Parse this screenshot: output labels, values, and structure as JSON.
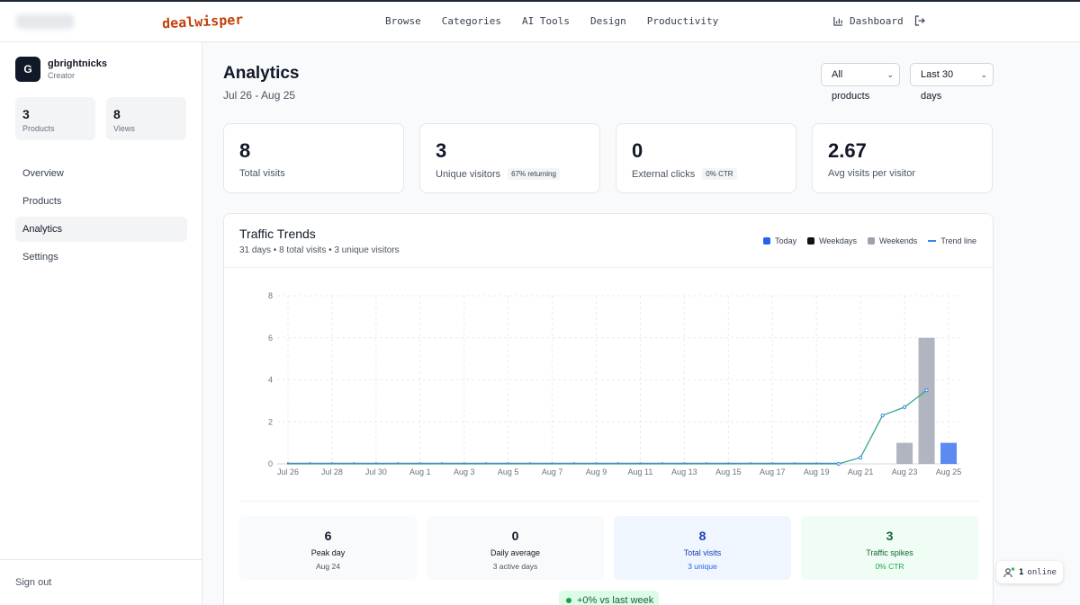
{
  "header": {
    "brand": "dealwisper",
    "nav": [
      "Browse",
      "Categories",
      "AI Tools",
      "Design",
      "Productivity"
    ],
    "dashboard_label": "Dashboard"
  },
  "sidebar": {
    "user": {
      "initial": "G",
      "name": "gbrightnicks",
      "role": "Creator"
    },
    "stats": [
      {
        "value": "3",
        "label": "Products"
      },
      {
        "value": "8",
        "label": "Views"
      }
    ],
    "nav": [
      "Overview",
      "Products",
      "Analytics",
      "Settings"
    ],
    "active": "Analytics",
    "signout": "Sign out"
  },
  "page": {
    "title": "Analytics",
    "date_range": "Jul 26 - Aug 25",
    "product_filter": "All products",
    "period_filter": "Last 30 days"
  },
  "cards": [
    {
      "value": "8",
      "label": "Total visits",
      "badge": ""
    },
    {
      "value": "3",
      "label": "Unique visitors",
      "badge": "67% returning"
    },
    {
      "value": "0",
      "label": "External clicks",
      "badge": "0% CTR"
    },
    {
      "value": "2.67",
      "label": "Avg visits per visitor",
      "badge": ""
    }
  ],
  "traffic": {
    "title": "Traffic Trends",
    "subtitle": "31 days • 8 total visits • 3 unique visitors",
    "legend": [
      {
        "label": "Today",
        "color": "#2563eb"
      },
      {
        "label": "Weekdays",
        "color": "#111111"
      },
      {
        "label": "Weekends",
        "color": "#9ca3af"
      },
      {
        "label": "Trend line",
        "color": "#3b82f6"
      }
    ]
  },
  "chart_data": {
    "type": "bar",
    "x_tick_labels": [
      "Jul 26",
      "Jul 28",
      "Jul 30",
      "Aug 1",
      "Aug 3",
      "Aug 5",
      "Aug 7",
      "Aug 9",
      "Aug 11",
      "Aug 13",
      "Aug 15",
      "Aug 17",
      "Aug 19",
      "Aug 21",
      "Aug 23",
      "Aug 25"
    ],
    "y_ticks": [
      0,
      2,
      4,
      6,
      8
    ],
    "ylim": [
      0,
      8
    ],
    "grid": true,
    "days": 31,
    "values": [
      0,
      0,
      0,
      0,
      0,
      0,
      0,
      0,
      0,
      0,
      0,
      0,
      0,
      0,
      0,
      0,
      0,
      0,
      0,
      0,
      0,
      0,
      0,
      0,
      0,
      0,
      0,
      0,
      1,
      6,
      1
    ],
    "bar_colors": {
      "28": "#9ca3af",
      "29": "#9ca3af",
      "30": "#2563eb"
    },
    "trend_line": [
      0,
      0,
      0,
      0,
      0,
      0,
      0,
      0,
      0,
      0,
      0,
      0,
      0,
      0,
      0,
      0,
      0,
      0,
      0,
      0,
      0,
      0,
      0,
      0,
      0,
      0,
      0.3,
      2.3,
      2.7,
      3.5
    ],
    "trend_color": "#3b82f6",
    "baseline_color": "#5b6ee1"
  },
  "summary": [
    {
      "value": "6",
      "title": "Peak day",
      "sub": "Aug 24",
      "bg": "#f9fafb",
      "color": "#111827",
      "sub_color": "#4b5563"
    },
    {
      "value": "0",
      "title": "Daily average",
      "sub": "3 active days",
      "bg": "#f9fafb",
      "color": "#111827",
      "sub_color": "#4b5563"
    },
    {
      "value": "8",
      "title": "Total visits",
      "sub": "3 unique",
      "bg": "#eff6ff",
      "color": "#1e40af",
      "sub_color": "#2563eb"
    },
    {
      "value": "3",
      "title": "Traffic spikes",
      "sub": "0% CTR",
      "bg": "#f0fdf4",
      "color": "#166534",
      "sub_color": "#16a34a"
    }
  ],
  "comparison": "+0% vs last week",
  "online": {
    "count": "1",
    "label": "online"
  }
}
